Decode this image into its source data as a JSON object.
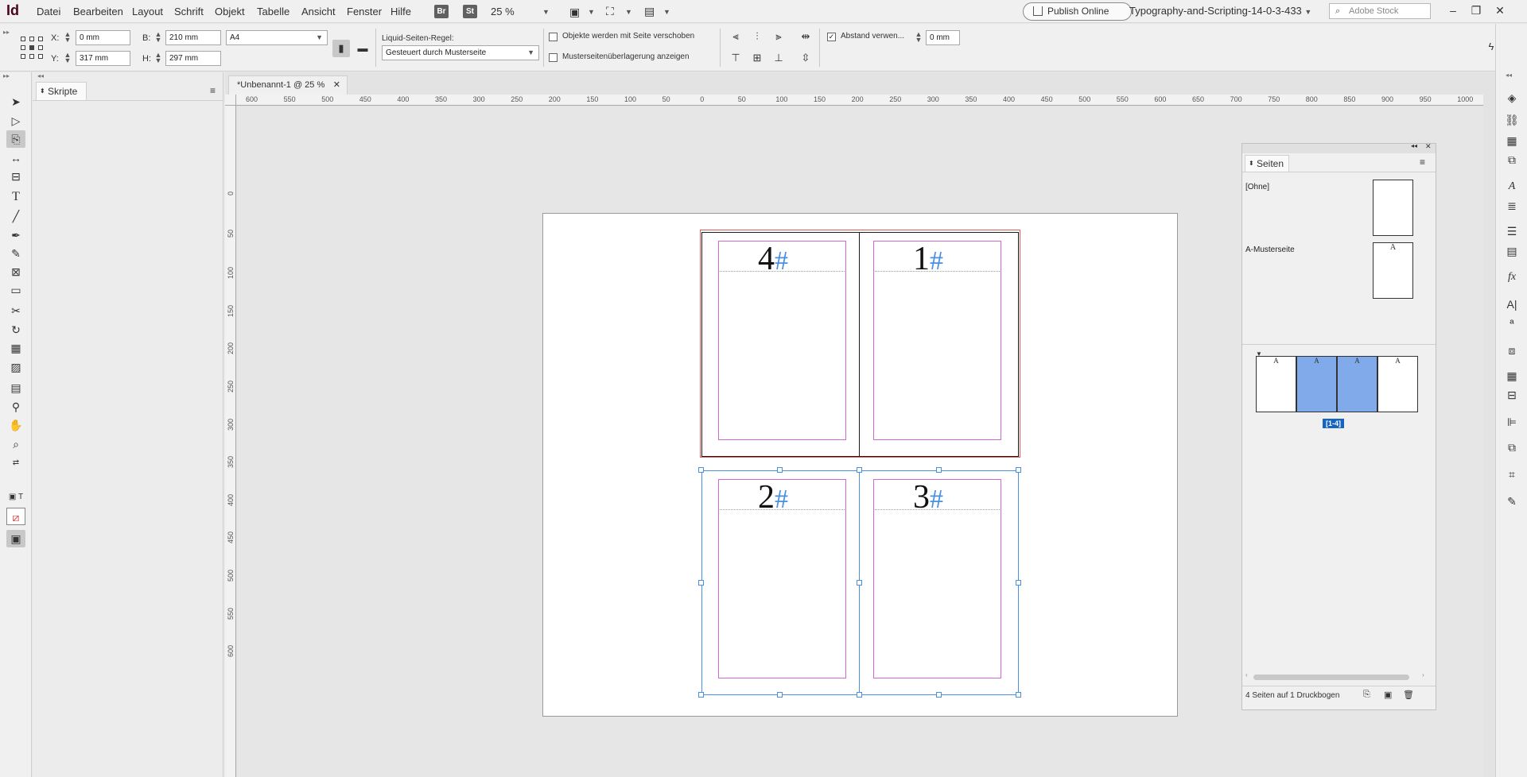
{
  "app": {
    "logo": "Id"
  },
  "menu": [
    "Datei",
    "Bearbeiten",
    "Layout",
    "Schrift",
    "Objekt",
    "Tabelle",
    "Ansicht",
    "Fenster",
    "Hilfe"
  ],
  "badges": {
    "bridge": "Br",
    "stock": "St"
  },
  "zoom": "25 %",
  "publish_label": "Publish Online",
  "workspace": "Typography-and-Scripting-14-0-3-433",
  "search_placeholder": "Adobe Stock",
  "control": {
    "x_label": "X:",
    "x_value": "0 mm",
    "y_label": "Y:",
    "y_value": "317 mm",
    "w_label": "B:",
    "w_value": "210 mm",
    "h_label": "H:",
    "h_value": "297 mm",
    "preset": "A4",
    "liquid_label": "Liquid-Seiten-Regel:",
    "liquid_value": "Gesteuert durch Musterseite",
    "cb_move_objects": "Objekte werden mit Seite verschoben",
    "cb_show_master": "Musterseitenüberlagerung anzeigen",
    "cb_spacing": "Abstand verwen...",
    "spacing_value": "0 mm"
  },
  "scripts_tab": "Skripte",
  "doc_tab": "*Unbenannt-1 @ 25 %",
  "ruler_h": [
    "600",
    "550",
    "500",
    "450",
    "400",
    "350",
    "300",
    "250",
    "200",
    "150",
    "100",
    "50",
    "0",
    "50",
    "100",
    "150",
    "200",
    "250",
    "300",
    "350",
    "400",
    "450",
    "500",
    "550",
    "600",
    "650",
    "700",
    "750",
    "800",
    "850",
    "900",
    "950",
    "1000"
  ],
  "ruler_v": [
    "0",
    "50",
    "100",
    "150",
    "200",
    "250",
    "300",
    "350",
    "400",
    "450",
    "500",
    "550",
    "600"
  ],
  "spread_pages": [
    {
      "num": "4",
      "hash": "#"
    },
    {
      "num": "1",
      "hash": "#"
    },
    {
      "num": "2",
      "hash": "#"
    },
    {
      "num": "3",
      "hash": "#"
    }
  ],
  "pages_panel": {
    "tab": "Seiten",
    "none_label": "[Ohne]",
    "master_label": "A-Musterseite",
    "master_letter": "A",
    "page_letters": [
      "A",
      "A",
      "A",
      "A"
    ],
    "range": "[1-4]",
    "footer": "4 Seiten auf 1 Druckbogen"
  }
}
